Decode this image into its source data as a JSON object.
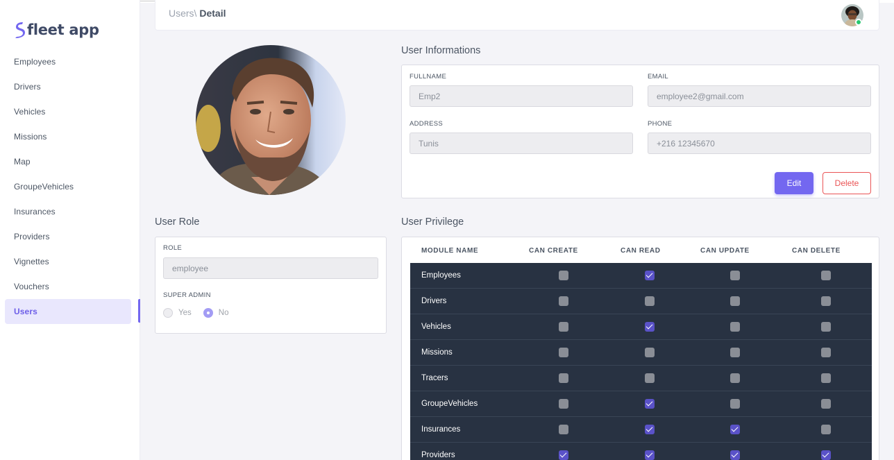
{
  "app": {
    "name": "fleet app"
  },
  "sidebar": {
    "items": [
      {
        "label": "Employees",
        "active": false
      },
      {
        "label": "Drivers",
        "active": false
      },
      {
        "label": "Vehicles",
        "active": false
      },
      {
        "label": "Missions",
        "active": false
      },
      {
        "label": "Map",
        "active": false
      },
      {
        "label": "GroupeVehicles",
        "active": false
      },
      {
        "label": "Insurances",
        "active": false
      },
      {
        "label": "Providers",
        "active": false
      },
      {
        "label": "Vignettes",
        "active": false
      },
      {
        "label": "Vouchers",
        "active": false
      },
      {
        "label": "Users",
        "active": true
      }
    ]
  },
  "header": {
    "breadcrumb_parent": "Users\\",
    "breadcrumb_current": "Detail"
  },
  "info": {
    "title": "User Informations",
    "fullname_label": "FULLNAME",
    "fullname_value": "Emp2",
    "email_label": "EMAIL",
    "email_value": "employee2@gmail.com",
    "address_label": "ADDRESS",
    "address_value": "Tunis",
    "phone_label": "PHONE",
    "phone_value": "+216 12345670",
    "edit_label": "Edit",
    "delete_label": "Delete"
  },
  "role": {
    "title": "User Role",
    "role_label": "ROLE",
    "role_value": "employee",
    "super_admin_label": "SUPER ADMIN",
    "yes_label": "Yes",
    "no_label": "No",
    "super_admin_value": "No"
  },
  "privilege": {
    "title": "User Privilege",
    "columns": [
      "MODULE NAME",
      "CAN CREATE",
      "CAN READ",
      "CAN UPDATE",
      "CAN DELETE"
    ],
    "rows": [
      {
        "name": "Employees",
        "create": false,
        "read": true,
        "update": false,
        "delete": false
      },
      {
        "name": "Drivers",
        "create": false,
        "read": false,
        "update": false,
        "delete": false
      },
      {
        "name": "Vehicles",
        "create": false,
        "read": true,
        "update": false,
        "delete": false
      },
      {
        "name": "Missions",
        "create": false,
        "read": false,
        "update": false,
        "delete": false
      },
      {
        "name": "Tracers",
        "create": false,
        "read": false,
        "update": false,
        "delete": false
      },
      {
        "name": "GroupeVehicles",
        "create": false,
        "read": true,
        "update": false,
        "delete": false
      },
      {
        "name": "Insurances",
        "create": false,
        "read": true,
        "update": true,
        "delete": false
      },
      {
        "name": "Providers",
        "create": true,
        "read": true,
        "update": true,
        "delete": true
      }
    ]
  },
  "colors": {
    "accent": "#7367f0",
    "danger": "#ea5455",
    "table_bg": "#283242",
    "online": "#28c76f"
  }
}
